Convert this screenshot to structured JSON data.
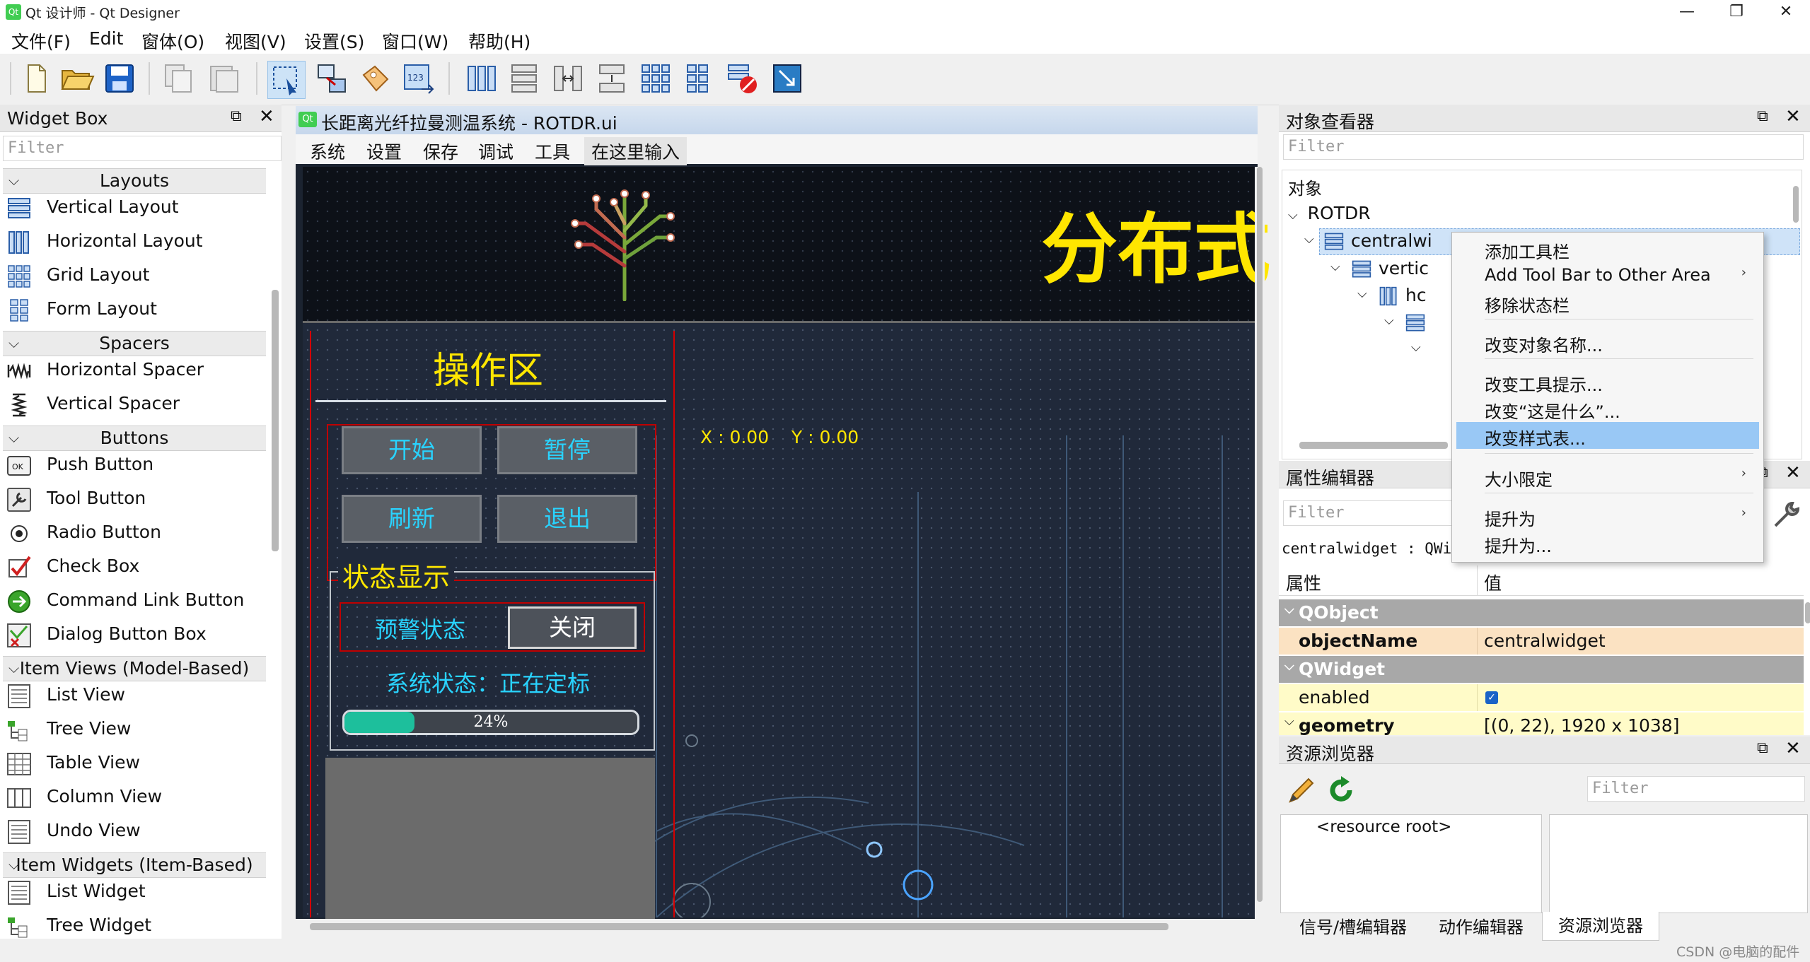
{
  "window": {
    "title": "Qt 设计师 - Qt Designer",
    "app_icon": "Qt"
  },
  "menubar": [
    "文件(F)",
    "Edit",
    "窗体(O)",
    "视图(V)",
    "设置(S)",
    "窗口(W)",
    "帮助(H)"
  ],
  "widget_box": {
    "title": "Widget Box",
    "filter_placeholder": "Filter",
    "categories": {
      "layouts": "Layouts",
      "spacers": "Spacers",
      "buttons": "Buttons",
      "item_views": "Item Views (Model-Based)",
      "item_widgets": "Item Widgets (Item-Based)"
    },
    "items": {
      "vertical_layout": "Vertical Layout",
      "horizontal_layout": "Horizontal Layout",
      "grid_layout": "Grid Layout",
      "form_layout": "Form Layout",
      "horizontal_spacer": "Horizontal Spacer",
      "vertical_spacer": "Vertical Spacer",
      "push_button": "Push Button",
      "tool_button": "Tool Button",
      "radio_button": "Radio Button",
      "check_box": "Check Box",
      "command_link_button": "Command Link Button",
      "dialog_button_box": "Dialog Button Box",
      "list_view": "List View",
      "tree_view": "Tree View",
      "table_view": "Table View",
      "column_view": "Column View",
      "undo_view": "Undo View",
      "list_widget": "List Widget",
      "tree_widget": "Tree Widget"
    }
  },
  "form": {
    "title": "长距离光纤拉曼测温系统 - ROTDR.ui",
    "icon": "Qt",
    "menu": [
      "系统",
      "设置",
      "保存",
      "调试",
      "工具",
      "在这里输入"
    ],
    "banner_text": "分布式",
    "ops_title": "操作区",
    "buttons": {
      "start": "开始",
      "pause": "暂停",
      "refresh": "刷新",
      "exit": "退出"
    },
    "status_group": "状态显示",
    "alarm_label": "预警状态",
    "alarm_button": "关闭",
    "system_status": "系统状态：正在定标",
    "progress": {
      "value": 24,
      "text": "24%"
    },
    "coords": "X : 0.00    Y : 0.00"
  },
  "object_inspector": {
    "title": "对象查看器",
    "filter_placeholder": "Filter",
    "header": "对象",
    "tree": {
      "root": "ROTDR",
      "central": "centralwi",
      "vertical": "vertic",
      "horizontal": "hc"
    }
  },
  "context_menu": {
    "add_toolbar": "添加工具栏",
    "add_toolbar_other": "Add Tool Bar to Other Area",
    "remove_status": "移除状态栏",
    "rename": "改变对象名称...",
    "tooltip": "改变工具提示...",
    "whatsthis": "改变“这是什么”...",
    "stylesheet": "改变样式表...",
    "size_constraints": "大小限定",
    "promote_to_sub": "提升为",
    "promote_to": "提升为..."
  },
  "property_editor": {
    "title": "属性编辑器",
    "filter_placeholder": "Filter",
    "object_line": "centralwidget : QWi",
    "col_property": "属性",
    "col_value": "值",
    "qobject": "QObject",
    "objectname_label": "objectName",
    "objectname_value": "centralwidget",
    "qwidget": "QWidget",
    "enabled_label": "enabled",
    "geometry_label": "geometry",
    "geometry_value": "[(0, 22), 1920 x 1038]"
  },
  "resource_browser": {
    "title": "资源浏览器",
    "filter_placeholder": "Filter",
    "root": "<resource root>",
    "tabs": [
      "信号/槽编辑器",
      "动作编辑器",
      "资源浏览器"
    ]
  },
  "watermark": "CSDN @电脑的配件",
  "colors": {
    "accent_select": "#99c8f5",
    "progress_fill": "#1dbf9c",
    "cyan_text": "#29d3ff",
    "yellow_text": "#ffe600"
  }
}
